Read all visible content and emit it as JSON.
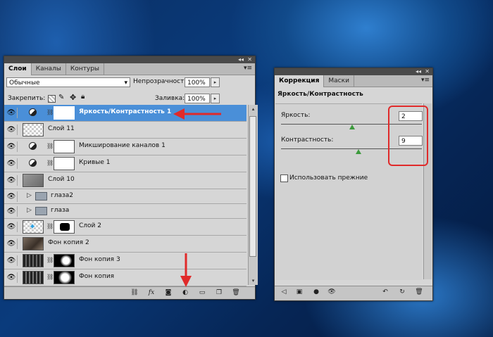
{
  "layers_panel": {
    "tabs": [
      {
        "label": "Слои",
        "active": true
      },
      {
        "label": "Каналы",
        "active": false
      },
      {
        "label": "Контуры",
        "active": false
      }
    ],
    "blend_mode": "Обычные",
    "opacity_label": "Непрозрачность:",
    "opacity_value": "100%",
    "lock_label": "Закрепить:",
    "fill_label": "Заливка:",
    "fill_value": "100%",
    "layers": [
      {
        "name": "Яркость/Контрастность 1",
        "type": "adjustment",
        "selected": true
      },
      {
        "name": "Слой 11",
        "type": "transparent"
      },
      {
        "name": "Микширование каналов 1",
        "type": "adjustment"
      },
      {
        "name": "Кривые 1",
        "type": "adjustment"
      },
      {
        "name": "Слой 10",
        "type": "gray"
      },
      {
        "name": "глаза2",
        "type": "group"
      },
      {
        "name": "глаза",
        "type": "group"
      },
      {
        "name": "Слой 2",
        "type": "masked"
      },
      {
        "name": "Фон копия 2",
        "type": "photo"
      },
      {
        "name": "Фон копия 3",
        "type": "photo-mask"
      },
      {
        "name": "Фон копия",
        "type": "photo-mask"
      }
    ],
    "bottom_icons": [
      "link-icon",
      "fx-icon",
      "mask-icon",
      "adjustment-icon",
      "group-icon",
      "new-layer-icon",
      "trash-icon"
    ]
  },
  "correction_panel": {
    "tabs": [
      {
        "label": "Коррекция",
        "active": true
      },
      {
        "label": "Маски",
        "active": false
      }
    ],
    "title": "Яркость/Контрастность",
    "brightness_label": "Яркость:",
    "brightness_value": "2",
    "contrast_label": "Контрастность:",
    "contrast_value": "9",
    "legacy_label": "Использовать прежние",
    "legacy_checked": false,
    "bottom_icons": [
      "back-icon",
      "clip-icon",
      "visibility-icon",
      "eye-icon",
      "reset-previous-icon",
      "reset-icon",
      "trash-icon"
    ]
  },
  "colors": {
    "selected_row": "#4a8fd8",
    "annotation_red": "#e02a2a",
    "panel_bg": "#d6d6d6"
  }
}
